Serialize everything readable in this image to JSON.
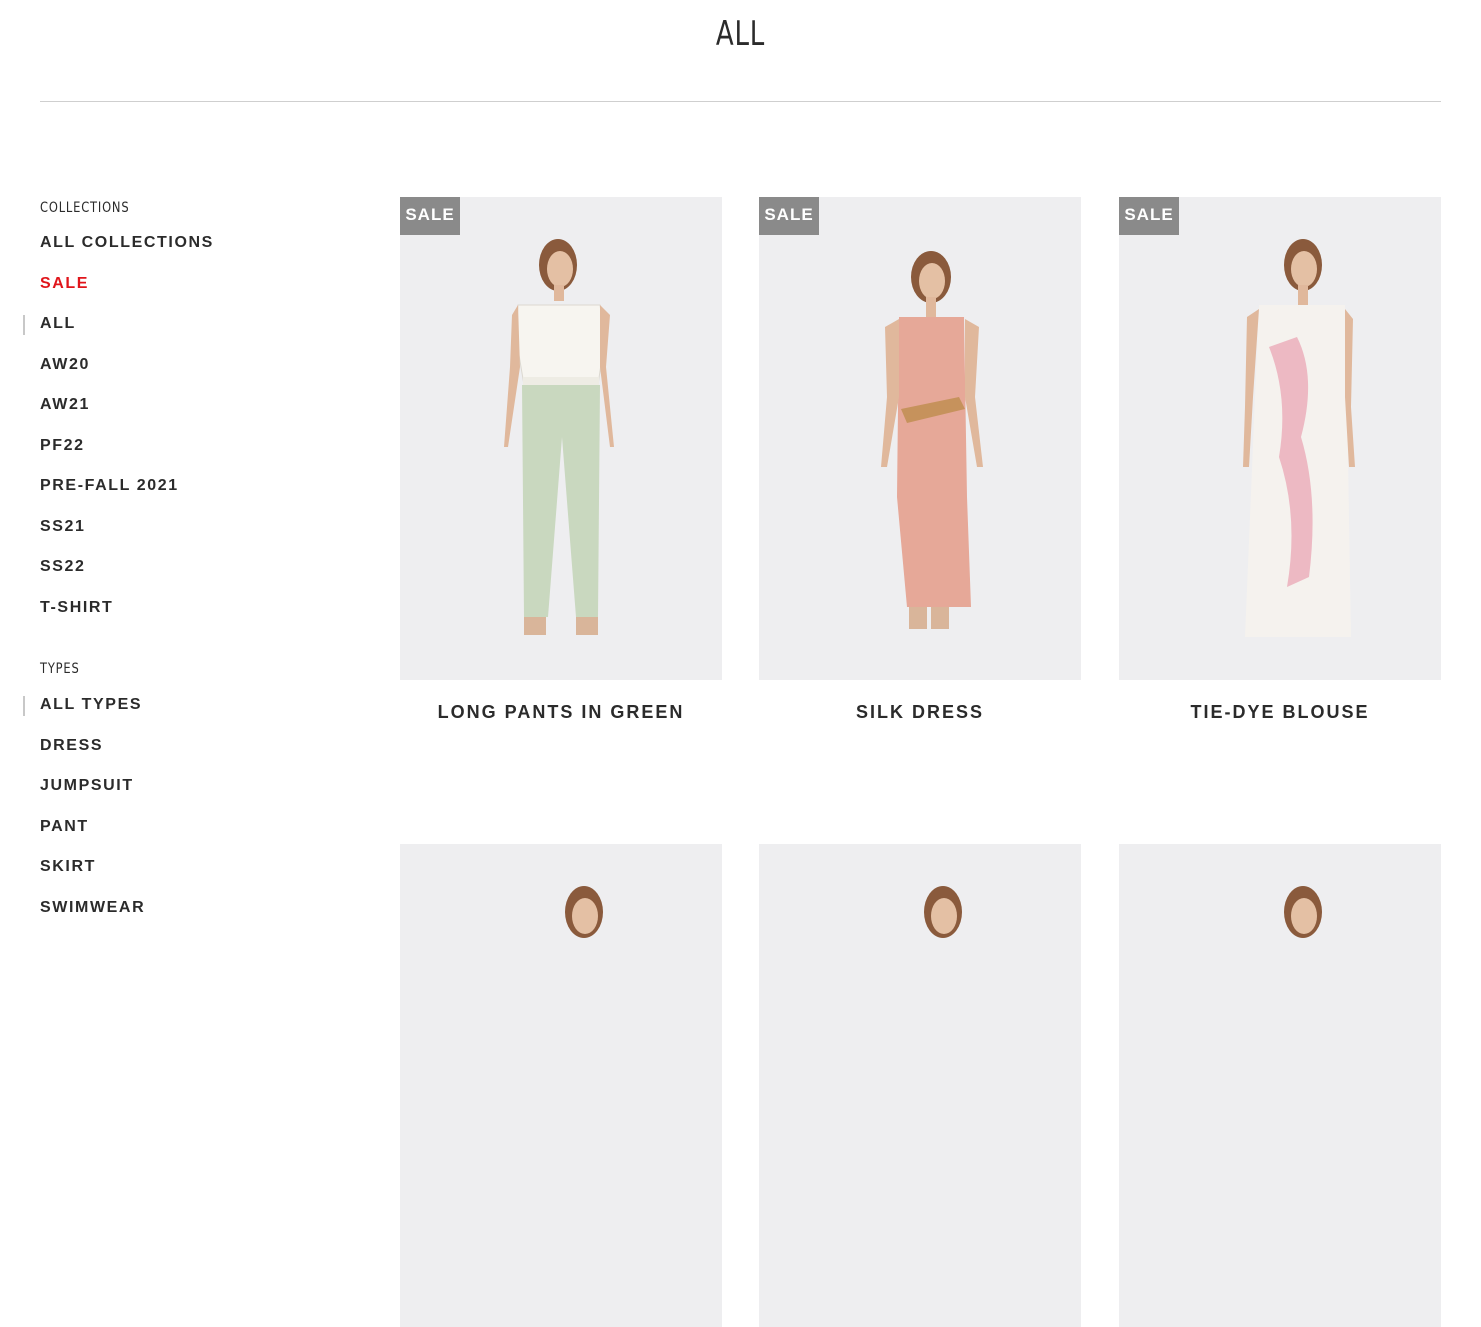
{
  "page": {
    "title": "ALL"
  },
  "sidebar": {
    "collections_heading": "COLLECTIONS",
    "collections": [
      {
        "label": "ALL COLLECTIONS"
      },
      {
        "label": "SALE"
      },
      {
        "label": "ALL"
      },
      {
        "label": "AW20"
      },
      {
        "label": "AW21"
      },
      {
        "label": "PF22"
      },
      {
        "label": "PRE-FALL 2021"
      },
      {
        "label": "SS21"
      },
      {
        "label": "SS22"
      },
      {
        "label": "T-SHIRT"
      }
    ],
    "types_heading": "TYPES",
    "types": [
      {
        "label": "ALL TYPES"
      },
      {
        "label": "DRESS"
      },
      {
        "label": "JUMPSUIT"
      },
      {
        "label": "PANT"
      },
      {
        "label": "SKIRT"
      },
      {
        "label": "SWIMWEAR"
      }
    ]
  },
  "products": [
    {
      "title": "LONG PANTS IN GREEN",
      "badge": "SALE"
    },
    {
      "title": "SILK DRESS",
      "badge": "SALE"
    },
    {
      "title": "TIE-DYE BLOUSE",
      "badge": "SALE"
    },
    {
      "title": ""
    },
    {
      "title": ""
    },
    {
      "title": ""
    }
  ],
  "colors": {
    "sale_text": "#e0151b",
    "badge_bg": "#8a8a8a",
    "image_bg": "#eeeef0"
  }
}
